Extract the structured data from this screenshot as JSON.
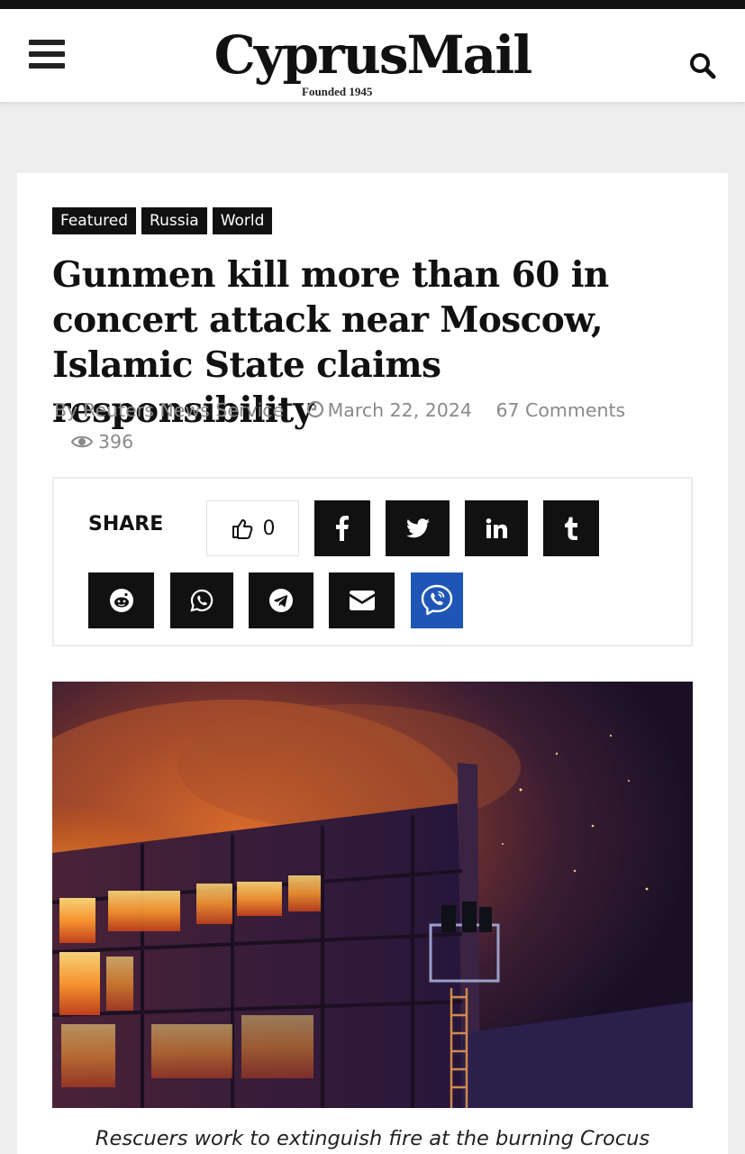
{
  "header": {
    "logo": "CyprusMail",
    "tagline": "Founded 1945"
  },
  "article": {
    "tags": [
      "Featured",
      "Russia",
      "World"
    ],
    "title": "Gunmen kill more than 60 in concert attack near Moscow, Islamic State claims responsibility",
    "author_prefix": "By",
    "author": "Reuters News Service",
    "date": "March 22, 2024",
    "comments": "67 Comments",
    "views": "396",
    "share_label": "SHARE",
    "likes": "0",
    "caption": "Rescuers work to extinguish fire at the burning Crocus"
  },
  "share_buttons": [
    "facebook",
    "twitter",
    "linkedin",
    "tumblr",
    "reddit",
    "whatsapp",
    "telegram",
    "email",
    "viber"
  ],
  "colors": {
    "button_dark": "#111111",
    "viber": "#1f56b6",
    "meta_gray": "#8a8a8a"
  }
}
